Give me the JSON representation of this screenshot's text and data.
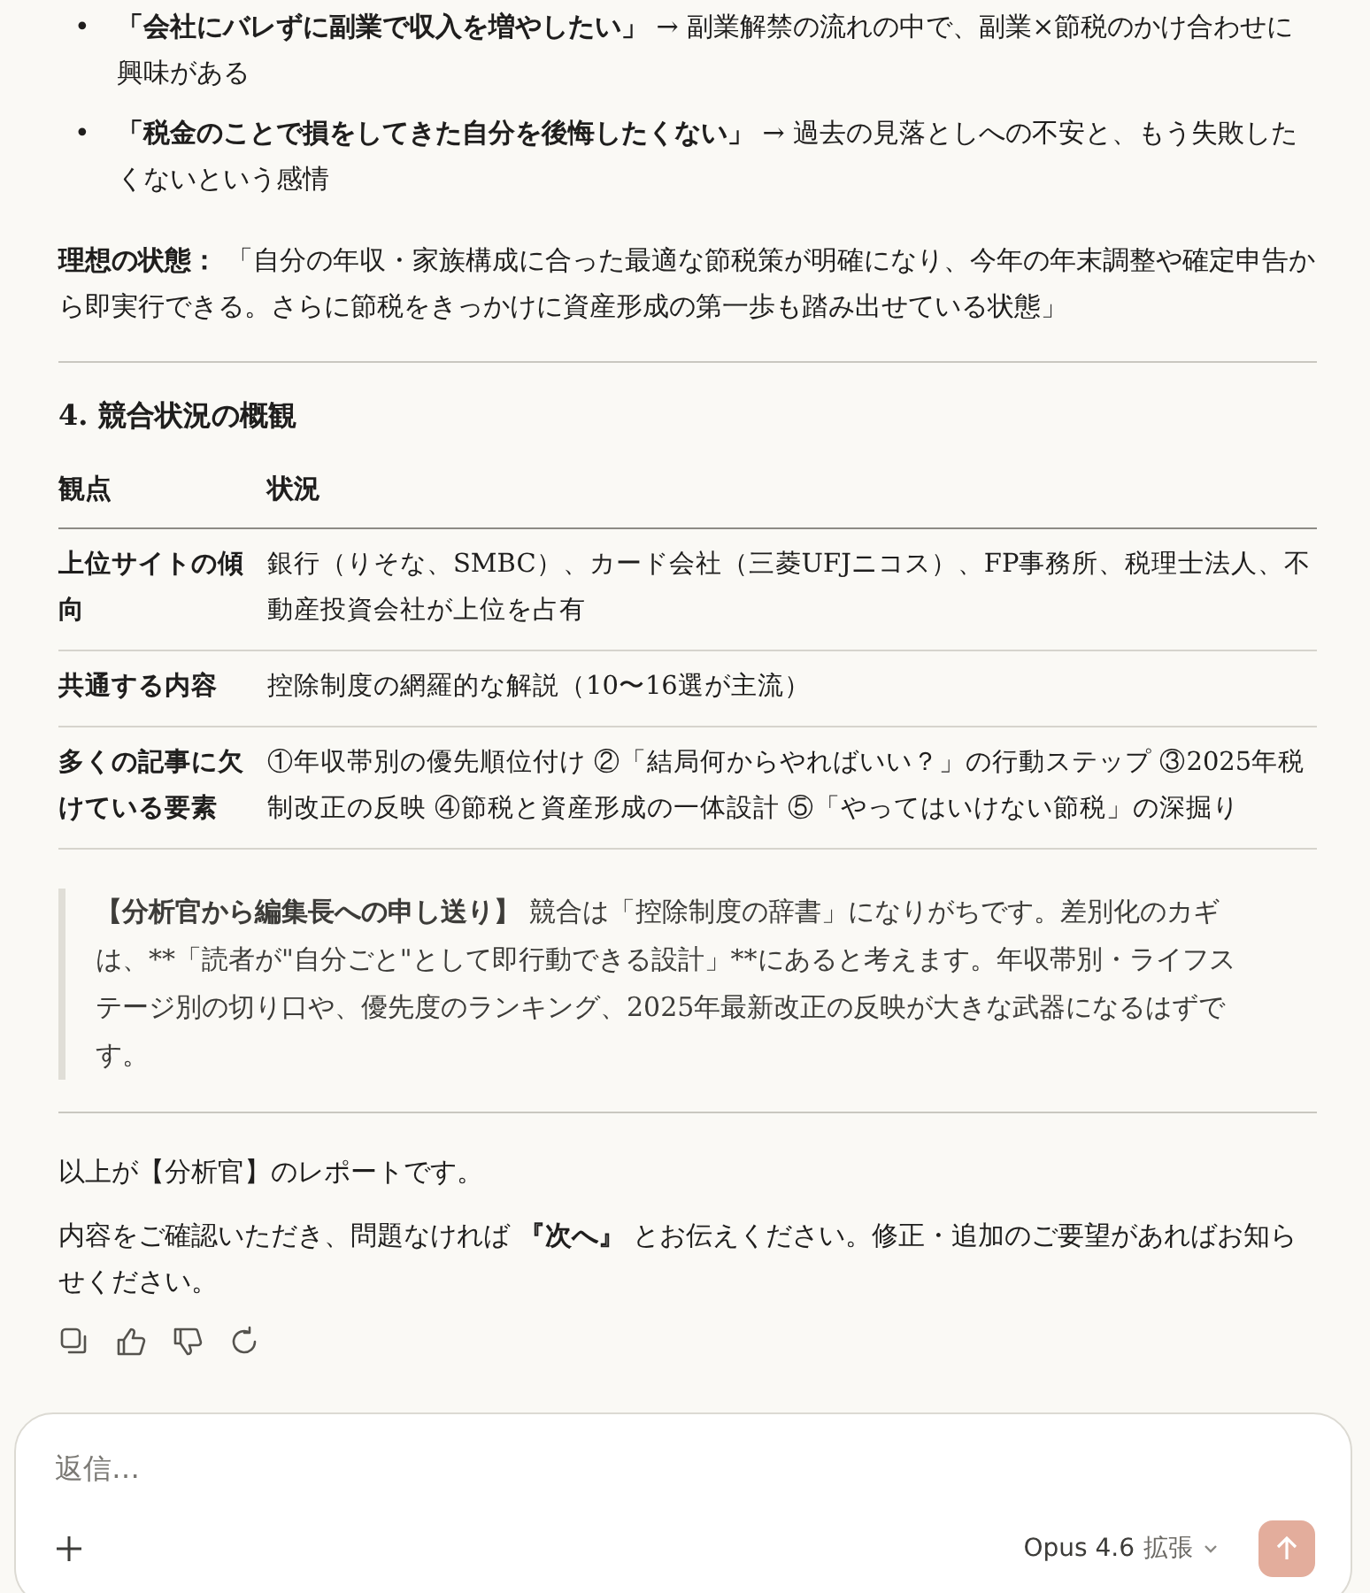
{
  "bullets": [
    {
      "marker": "•",
      "text": "**「会社にバレずに副業で収入を増やしたい」** → 副業解禁の流れの中で、副業×節税のかけ合わせに興味がある"
    },
    {
      "marker": "•",
      "text": "**「税金のことで損をしてきた自分を後悔したくない」** → 過去の見落としへの不安と、もう失敗したくないという感情"
    }
  ],
  "ideal": "**理想の状態：** 「自分の年収・家族構成に合った最適な節税策が明確になり、今年の年末調整や確定申告から即実行できる。さらに節税をきっかけに資産形成の第一歩も踏み出せている状態」",
  "section_heading": "4. 競合状況の概観",
  "table": {
    "columns": [
      "観点",
      "状況"
    ],
    "rows": [
      [
        "上位サイトの傾向",
        "銀行（りそな、SMBC）、カード会社（三菱UFJニコス）、FP事務所、税理士法人、不動産投資会社が上位を占有"
      ],
      [
        "共通する内容",
        "控除制度の網羅的な解説（10〜16選が主流）"
      ],
      [
        "多くの記事に欠けている要素",
        "①年収帯別の優先順位付け ②「結局何からやればいい？」の行動ステップ ③2025年税制改正の反映 ④節税と資産形成の一体設計 ⑤「やってはいけない節税」の深掘り"
      ]
    ]
  },
  "note": {
    "lead": "【分析官から編集長への申し送り】",
    "body": "競合は「控除制度の辞書」になりがちです。差別化のカギは、**「読者が\"自分ごと\"として即行動できる設計」**にあると考えます。年収帯別・ライフステージ別の切り口や、優先度のランキング、2025年最新改正の反映が大きな武器になるはずです。"
  },
  "closing": [
    "以上が【分析官】のレポートです。",
    "内容をご確認いただき、問題なければ **『次へ』** とお伝えください。修正・追加のご要望があればお知らせください。"
  ],
  "actions": [
    {
      "kind": "copy"
    },
    {
      "kind": "like"
    },
    {
      "kind": "dislike"
    },
    {
      "kind": "retry"
    }
  ],
  "composer": {
    "placeholder": "返信…",
    "model": "Opus 4.6",
    "mode": "拡張",
    "send_disabled": true
  }
}
